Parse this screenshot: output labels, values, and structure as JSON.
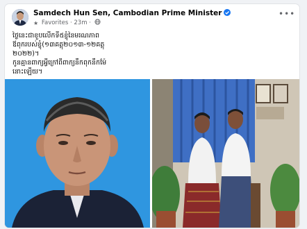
{
  "post": {
    "author": "Samdech Hun Sen, Cambodian Prime Minister",
    "audience_label": "Favorites",
    "separator": "·",
    "time": "23m",
    "separator2": "·",
    "text_lines": [
      "ថ្ងៃនេះជាខួបលើកទី៥ខ្ញុំនៃមរណភាព",
      "ឪពុករបស់ខ្ញុំ(១៣គត្តុ២០១៣-១២គត្តុ",
      "២០២២)។",
      "កូនគ្មានពាក្យអ្វីក្រៅពីពាក្យនឹកពុកនឹកម៉ែ",
      "នោះឡើយ។"
    ]
  },
  "icons": {
    "verified": "verified-badge-icon",
    "audience": "star-icon",
    "privacy": "globe-icon",
    "more": "more-options-icon"
  },
  "colors": {
    "verified_blue": "#1877f2",
    "left_photo_background": "#2f96e0",
    "curtain_blue": "#3f6fc4"
  }
}
